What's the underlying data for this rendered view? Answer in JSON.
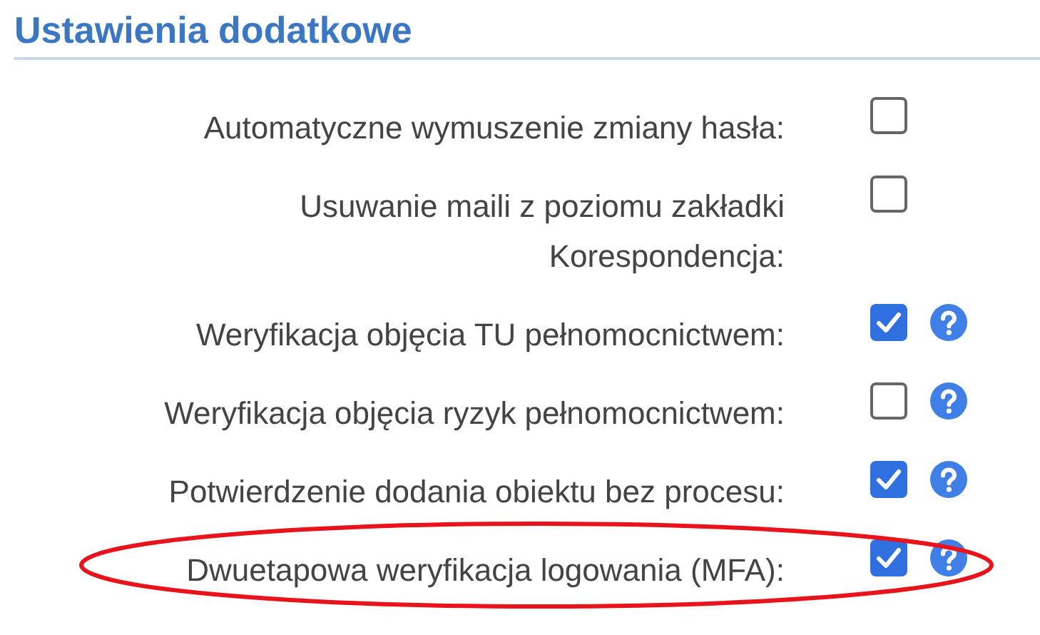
{
  "section": {
    "title": "Ustawienia dodatkowe"
  },
  "settings": [
    {
      "label": "Automatyczne wymuszenie zmiany hasła:",
      "checked": false,
      "help": false,
      "highlighted": false
    },
    {
      "label": "Usuwanie maili z poziomu zakładki Korespondencja:",
      "checked": false,
      "help": false,
      "highlighted": false
    },
    {
      "label": "Weryfikacja objęcia TU pełnomocnictwem:",
      "checked": true,
      "help": true,
      "highlighted": false
    },
    {
      "label": "Weryfikacja objęcia ryzyk pełnomocnictwem:",
      "checked": false,
      "help": true,
      "highlighted": false
    },
    {
      "label": "Potwierdzenie dodania obiektu bez procesu:",
      "checked": true,
      "help": true,
      "highlighted": false
    },
    {
      "label": "Dwuetapowa weryfikacja logowania (MFA):",
      "checked": true,
      "help": true,
      "highlighted": true
    }
  ]
}
